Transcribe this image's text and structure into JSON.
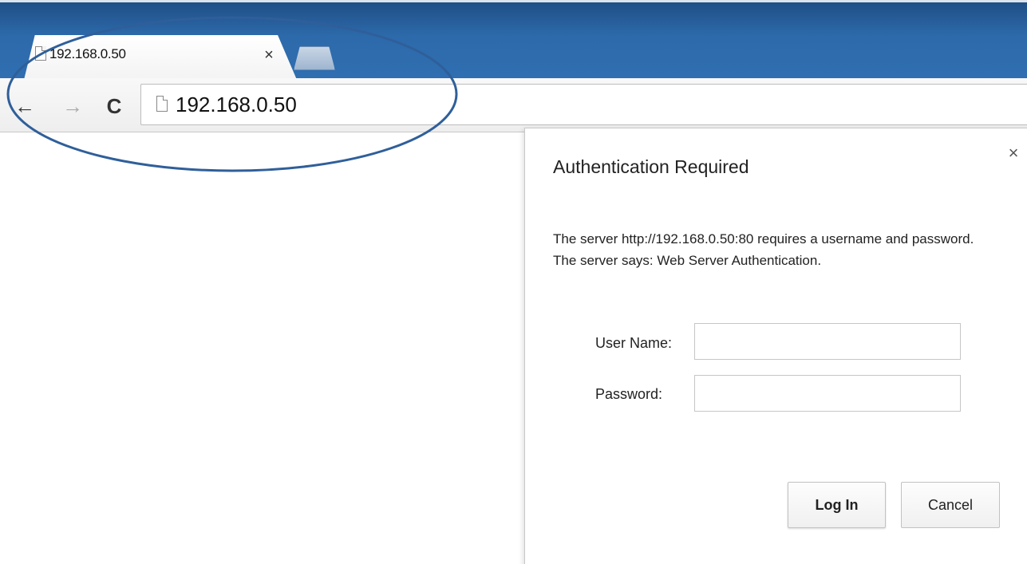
{
  "browser": {
    "tab": {
      "title": "192.168.0.50",
      "close_glyph": "×",
      "favicon": "page-icon"
    },
    "newtab": {
      "icon": "new-tab-icon"
    },
    "nav": {
      "back_glyph": "←",
      "forward_glyph": "→",
      "reload_glyph": "C"
    },
    "address_bar": {
      "url": "192.168.0.50",
      "icon": "page-icon"
    }
  },
  "dialog": {
    "title": "Authentication Required",
    "close_glyph": "×",
    "message": "The server http://192.168.0.50:80 requires a username and password. The server says: Web Server Authentication.",
    "username": {
      "label": "User Name:",
      "value": ""
    },
    "password": {
      "label": "Password:",
      "value": ""
    },
    "login_label": "Log In",
    "cancel_label": "Cancel"
  },
  "colors": {
    "titlebar": "#2d6aab",
    "annotation_ellipse": "#2f5f9a"
  }
}
